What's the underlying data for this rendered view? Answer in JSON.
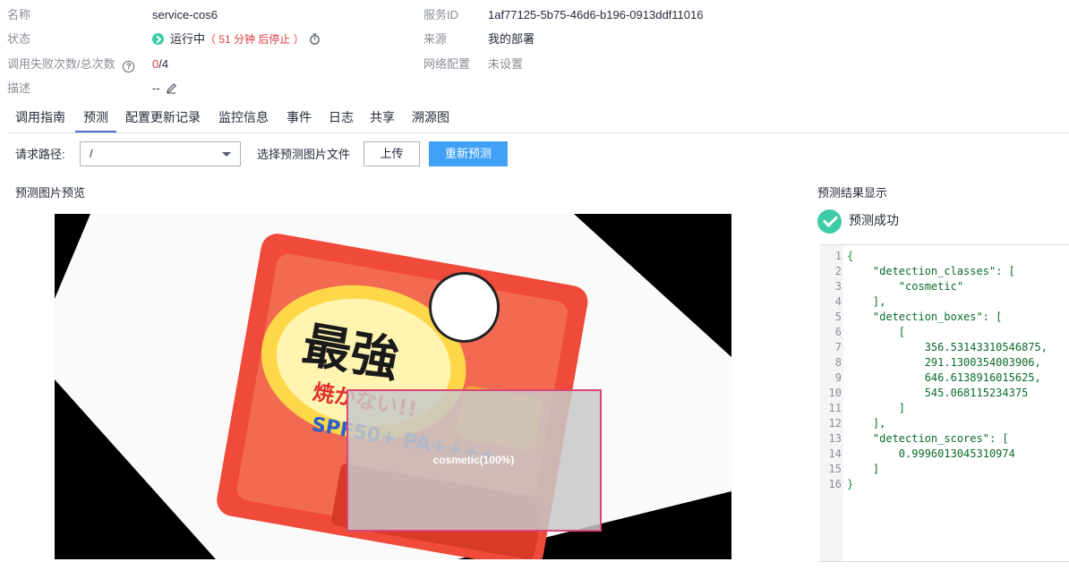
{
  "info": {
    "name_label": "名称",
    "name_value": "service-cos6",
    "status_label": "状态",
    "status_running": "运行中",
    "status_countdown": "（ 51 分钟 后停止 ）",
    "calls_label": "调用失败次数/总次数",
    "calls_failed": "0",
    "calls_total": "/4",
    "desc_label": "描述",
    "desc_value": "--",
    "service_id_label": "服务ID",
    "service_id_value": "1af77125-5b75-46d6-b196-0913ddf11016",
    "source_label": "来源",
    "source_value": "我的部署",
    "network_label": "网络配置",
    "network_value": "未设置"
  },
  "tabs": [
    {
      "label": "调用指南"
    },
    {
      "label": "预测"
    },
    {
      "label": "配置更新记录"
    },
    {
      "label": "监控信息"
    },
    {
      "label": "事件"
    },
    {
      "label": "日志"
    },
    {
      "label": "共享"
    },
    {
      "label": "溯源图"
    }
  ],
  "active_tab": "预测",
  "predict": {
    "path_label": "请求路径:",
    "path_value": "/",
    "choose_label": "选择预测图片文件",
    "upload_button": "上传",
    "repredict_button": "重新预测",
    "preview_title": "预测图片预览",
    "detection_label": "cosmetic(100%)",
    "product_text": "最強",
    "product_subtext": "焼かない!!",
    "spf_text": "SPF50+ PA++++"
  },
  "result": {
    "title": "预测结果显示",
    "success_text": "预测成功",
    "lines": [
      {
        "n": "1",
        "text": "{"
      },
      {
        "n": "2",
        "text": "    \"detection_classes\": ["
      },
      {
        "n": "3",
        "text": "        \"cosmetic\""
      },
      {
        "n": "4",
        "text": "    ],"
      },
      {
        "n": "5",
        "text": "    \"detection_boxes\": ["
      },
      {
        "n": "6",
        "text": "        ["
      },
      {
        "n": "7",
        "text": "            356.53143310546875,"
      },
      {
        "n": "8",
        "text": "            291.1300354003906,"
      },
      {
        "n": "9",
        "text": "            646.6138916015625,"
      },
      {
        "n": "10",
        "text": "            545.068115234375"
      },
      {
        "n": "11",
        "text": "        ]"
      },
      {
        "n": "12",
        "text": "    ],"
      },
      {
        "n": "13",
        "text": "    \"detection_scores\": ["
      },
      {
        "n": "14",
        "text": "        0.9996013045310974"
      },
      {
        "n": "15",
        "text": "    ]"
      },
      {
        "n": "16",
        "text": "}"
      }
    ]
  },
  "colors": {
    "accent_blue": "#3fa0f5",
    "success_green": "#3dcca6",
    "danger_red": "#e0393e",
    "detection_box": "#d94677"
  },
  "icons": [
    "status-running-icon",
    "timer-icon",
    "help-icon",
    "edit-icon",
    "dropdown-caret-icon",
    "success-check-icon"
  ]
}
